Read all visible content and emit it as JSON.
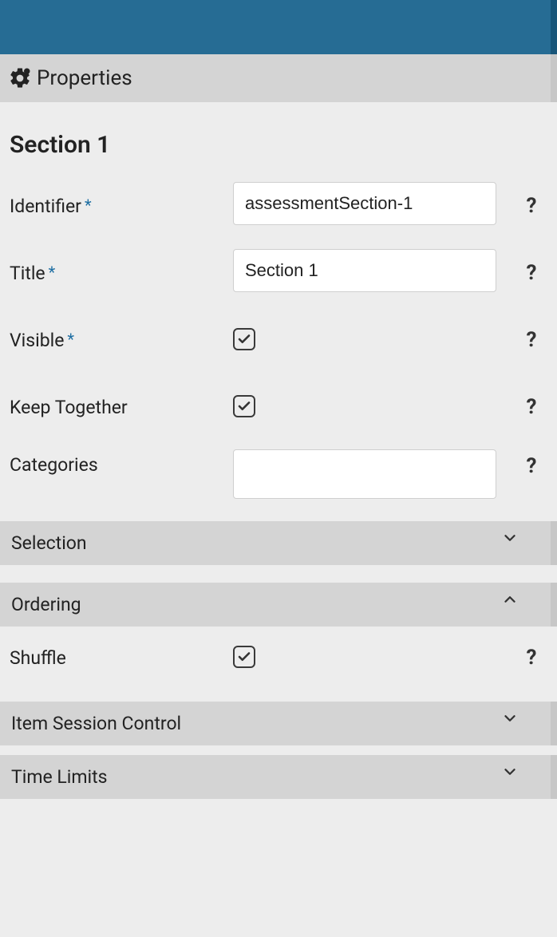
{
  "header": {
    "title": "Properties"
  },
  "section": {
    "title": "Section 1"
  },
  "form": {
    "identifier": {
      "label": "Identifier",
      "value": "assessmentSection-1",
      "required": true
    },
    "title": {
      "label": "Title",
      "value": "Section 1",
      "required": true
    },
    "visible": {
      "label": "Visible",
      "checked": true,
      "required": true
    },
    "keepTogether": {
      "label": "Keep Together",
      "checked": true
    },
    "categories": {
      "label": "Categories",
      "value": ""
    },
    "shuffle": {
      "label": "Shuffle",
      "checked": true
    }
  },
  "accordions": {
    "selection": {
      "label": "Selection",
      "expanded": false
    },
    "ordering": {
      "label": "Ordering",
      "expanded": true
    },
    "itemSessionControl": {
      "label": "Item Session Control",
      "expanded": false
    },
    "timeLimits": {
      "label": "Time Limits",
      "expanded": false
    }
  },
  "glyphs": {
    "help": "?"
  }
}
